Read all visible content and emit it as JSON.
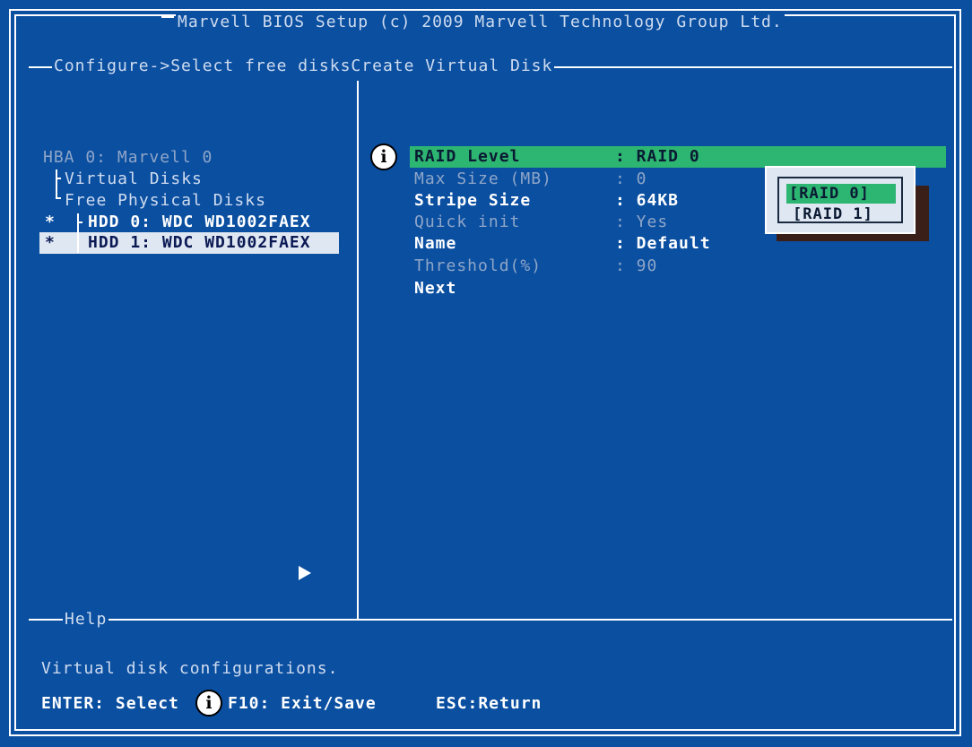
{
  "header": {
    "title": "Marvell BIOS Setup (c) 2009 Marvell Technology Group Ltd.",
    "path_label": "Configure->Select free disksCreate Virtual Disk"
  },
  "left_panel": {
    "hba": "HBA 0: Marvell 0",
    "virtual_disks": "Virtual Disks",
    "free_physical_disks": "Free Physical Disks",
    "disks": [
      {
        "marker": "*",
        "label": "HDD 0: WDC WD1002FAEX"
      },
      {
        "marker": "*",
        "label": "HDD 1: WDC WD1002FAEX"
      }
    ]
  },
  "settings": [
    {
      "label": "RAID Level",
      "value": ": RAID 0"
    },
    {
      "label": "Max Size (MB)",
      "value": ": 0"
    },
    {
      "label": "Stripe Size",
      "value": ": 64KB"
    },
    {
      "label": "Quick init",
      "value": ": Yes"
    },
    {
      "label": "Name",
      "value": ": Default"
    },
    {
      "label": "Threshold(%)",
      "value": ": 90"
    }
  ],
  "next_label": "Next",
  "popup": {
    "options": [
      "[RAID 0]",
      "[RAID 1]"
    ],
    "selected": "[RAID 0]"
  },
  "help": {
    "title": "Help",
    "text": "Virtual disk configurations.",
    "keys": {
      "enter": "ENTER: Select",
      "f10": "F10: Exit/Save",
      "esc": "ESC:Return"
    }
  },
  "icons": {
    "info": "info-circle-icon",
    "arrow": "right-triangle-icon"
  },
  "colors": {
    "background": "#0b4fa1",
    "highlight_green": "#2db572",
    "highlight_light": "#dfe7f2",
    "popup_shadow": "#3a1f18"
  }
}
